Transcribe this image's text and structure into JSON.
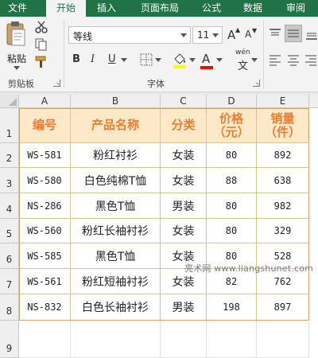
{
  "ribbon": {
    "tabs": [
      "文件",
      "开始",
      "插入",
      "页面布局",
      "公式",
      "数据",
      "审阅"
    ],
    "active_tab": "开始",
    "paste_label": "粘贴",
    "groups": {
      "clipboard": "剪贴板",
      "font": "字体"
    },
    "font_name": "等线",
    "font_size": "11",
    "bold": "B",
    "italic": "I",
    "underline": "U",
    "wen": "wén",
    "wen_char": "文",
    "grow_font": "A",
    "shrink_font": "A",
    "font_color": "A",
    "accent_color": "#217346",
    "font_color_bar": "#ff0000",
    "highlight_color_bar": "#ffff00"
  },
  "sheet": {
    "columns": [
      "A",
      "B",
      "C",
      "D",
      "E"
    ],
    "rows": [
      "1",
      "2",
      "3",
      "4",
      "5",
      "6",
      "7",
      "8",
      "9"
    ],
    "header": {
      "code": "编号",
      "name": "产品名称",
      "category": "分类",
      "price": "价格\n（元）",
      "sales": "销量\n（件）"
    },
    "data": [
      {
        "code": "WS-581",
        "name": "粉红衬衫",
        "category": "女装",
        "price": "80",
        "sales": "892"
      },
      {
        "code": "WS-580",
        "name": "白色纯棉T恤",
        "category": "女装",
        "price": "88",
        "sales": "638"
      },
      {
        "code": "NS-286",
        "name": "黑色T恤",
        "category": "男装",
        "price": "80",
        "sales": "982"
      },
      {
        "code": "WS-560",
        "name": "粉红长袖衬衫",
        "category": "女装",
        "price": "80",
        "sales": "329"
      },
      {
        "code": "WS-585",
        "name": "黑色T恤",
        "category": "女装",
        "price": "80",
        "sales": "528"
      },
      {
        "code": "WS-561",
        "name": "粉红短袖衬衫",
        "category": "女装",
        "price": "82",
        "sales": "762"
      },
      {
        "code": "NS-832",
        "name": "白色长袖衬衫",
        "category": "男装",
        "price": "198",
        "sales": "897"
      }
    ],
    "header_fill": "#fde9c7",
    "header_text_color": "#ed7d31"
  },
  "watermark": "亮术网 www.liangshunet.com"
}
